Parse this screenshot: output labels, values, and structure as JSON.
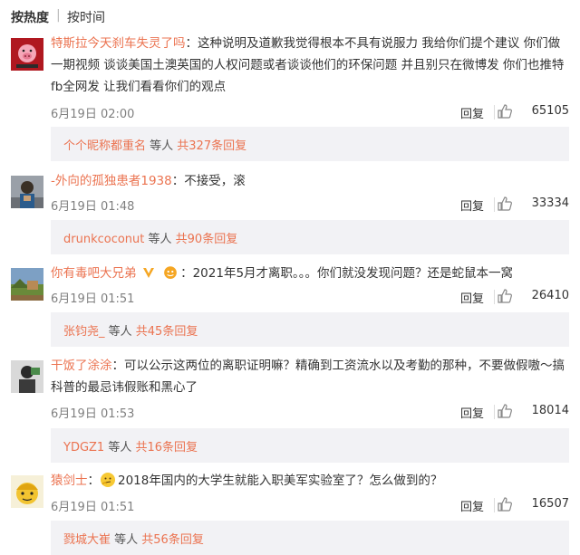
{
  "sort": {
    "hot": "按热度",
    "sep": "|",
    "time": "按时间"
  },
  "comments": [
    {
      "username": "特斯拉今天刹车失灵了吗",
      "text": "：这种说明及道歉我觉得根本不具有说服力 我给你们提个建议 你们做一期视频 谈谈美国土澳英国的人权问题或者谈谈他们的环保问题 并且别只在微博发 你们也推特fb全网发 让我们看看你们的观点",
      "date": "6月19日 02:00",
      "reply_label": "回复",
      "likes": "65105",
      "sub_user": "个个昵称都重名",
      "sub_others": " 等人 ",
      "sub_replies": "共327条回复"
    },
    {
      "username": "-外向的孤独患者1938",
      "text": "：不接受，滚",
      "date": "6月19日 01:48",
      "reply_label": "回复",
      "likes": "33334",
      "sub_user": "drunkcoconut",
      "sub_others": " 等人 ",
      "sub_replies": "共90条回复"
    },
    {
      "username": "你有毒吧大兄弟",
      "text": "：2021年5月才离职。。。你们就没发现问题？还是蛇鼠本一窝",
      "date": "6月19日 01:51",
      "reply_label": "回复",
      "likes": "26410",
      "sub_user": "张钧尧_",
      "sub_others": " 等人 ",
      "sub_replies": "共45条回复"
    },
    {
      "username": "干饭了涂涂",
      "text": "：可以公示这两位的离职证明嘛？精确到工资流水以及考勤的那种，不要做假嗷～搞科普的最忌讳假账和黑心了",
      "date": "6月19日 01:53",
      "reply_label": "回复",
      "likes": "18014",
      "sub_user": "YDGZ1",
      "sub_others": " 等人 ",
      "sub_replies": "共16条回复"
    },
    {
      "username": "猿剑士",
      "text": "2018年国内的大学生就能入职美军实验室了？怎么做到的？",
      "prefix": "：",
      "date": "6月19日 01:51",
      "reply_label": "回复",
      "likes": "16507",
      "sub_user": "戮城大崔",
      "sub_others": " 等人 ",
      "sub_replies": "共56条回复"
    }
  ],
  "colors": {
    "username": "#eb7350",
    "meta": "#808080",
    "subbox_bg": "#f2f2f5"
  }
}
